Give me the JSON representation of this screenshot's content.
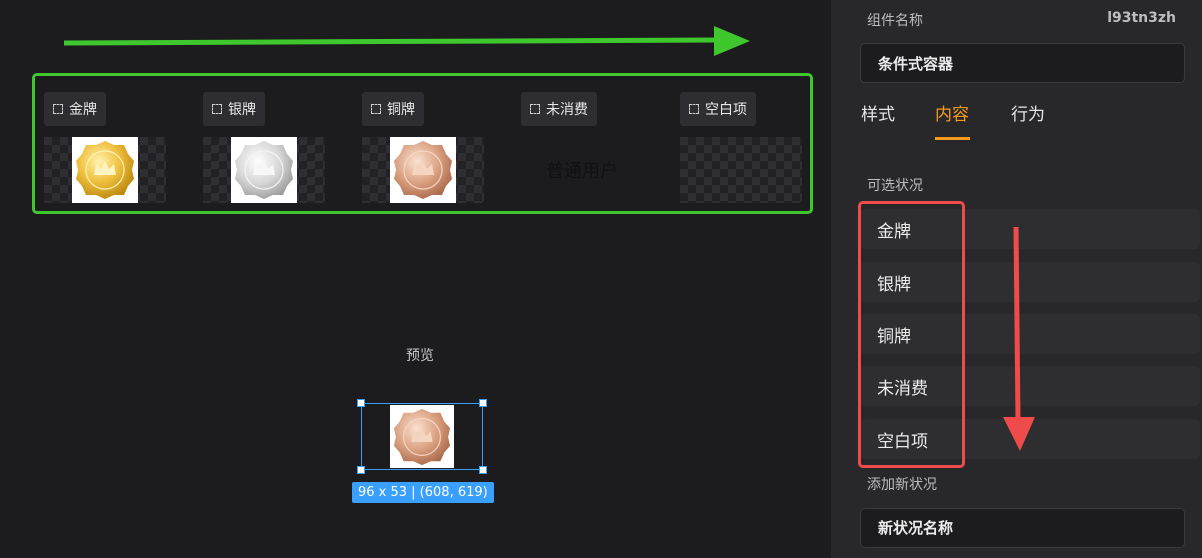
{
  "canvas": {
    "columns": [
      {
        "tag": "金牌",
        "medal": "gold"
      },
      {
        "tag": "银牌",
        "medal": "silver"
      },
      {
        "tag": "铜牌",
        "medal": "bronze"
      },
      {
        "tag": "未消费",
        "text": "普通用户"
      },
      {
        "tag": "空白项"
      }
    ],
    "preview_label": "预览",
    "size_badge": "96 x 53 | (608, 619)",
    "colors": {
      "annotation_green": "#3ec82e",
      "annotation_red": "#ef4b4b",
      "selection_blue": "#3aa0ff"
    }
  },
  "panel": {
    "component_label": "组件名称",
    "component_id": "l93tn3zh",
    "component_name": "条件式容器",
    "tabs": [
      {
        "label": "样式",
        "active": false
      },
      {
        "label": "内容",
        "active": true
      },
      {
        "label": "行为",
        "active": false
      }
    ],
    "states_label": "可选状况",
    "states": [
      "金牌",
      "银牌",
      "铜牌",
      "未消费",
      "空白项"
    ],
    "add_label": "添加新状况",
    "new_state_placeholder": "新状况名称",
    "accent": "#f39a1f"
  }
}
